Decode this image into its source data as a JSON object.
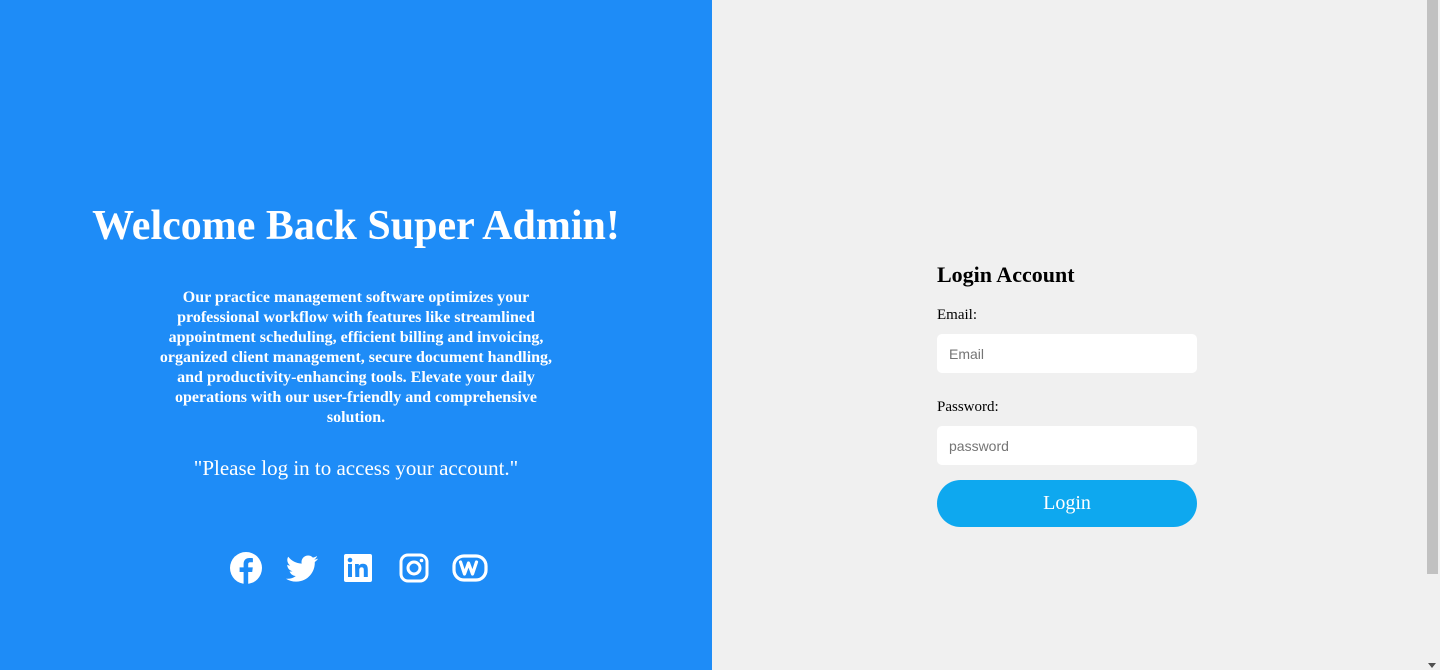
{
  "colors": {
    "left_background": "#1e8cf7",
    "right_background": "#f0f0f0",
    "login_button": "#0ea8ef"
  },
  "welcome": {
    "title": "Welcome Back Super Admin!",
    "description": "Our practice management software optimizes your professional workflow with features like streamlined appointment scheduling, efficient billing and invoicing, organized client management, secure document handling, and productivity-enhancing tools. Elevate your daily operations with our user-friendly and comprehensive solution.",
    "prompt": "\"Please log in to access your account.\""
  },
  "social": {
    "icons": [
      "facebook-icon",
      "twitter-icon",
      "linkedin-icon",
      "instagram-icon",
      "weebly-icon"
    ]
  },
  "login": {
    "heading": "Login Account",
    "email_label": "Email:",
    "email_placeholder": "Email",
    "email_value": "",
    "password_label": "Password:",
    "password_placeholder": "password",
    "password_value": "",
    "button_label": "Login"
  }
}
